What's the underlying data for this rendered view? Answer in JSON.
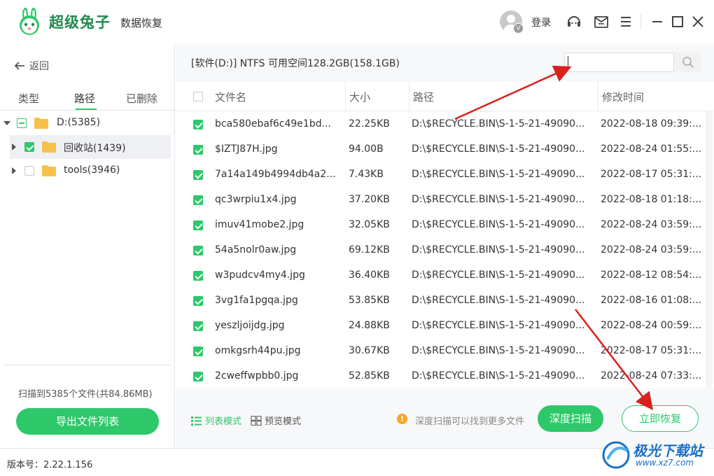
{
  "header": {
    "brand": "超级兔子",
    "brand_sub": "数据恢复",
    "login": "登录",
    "avatar_badge": "V"
  },
  "sidebar": {
    "back": "返回",
    "tabs": [
      {
        "label": "类型",
        "active": false
      },
      {
        "label": "路径",
        "active": true
      },
      {
        "label": "已删除",
        "active": false
      }
    ],
    "tree": [
      {
        "label": "D:(5385)",
        "check": "partial",
        "expanded": true
      },
      {
        "label": "回收站(1439)",
        "check": "checked",
        "expanded": false
      },
      {
        "label": "tools(3946)",
        "check": "unchecked",
        "expanded": false
      }
    ],
    "scan_summary": "扫描到5385个文件(共84.86MB)",
    "export_button": "导出文件列表"
  },
  "main": {
    "drive_info": "[软件(D:)] NTFS 可用空间128.2GB(158.1GB)",
    "search": {
      "value": "",
      "placeholder": ""
    },
    "columns": [
      "文件名",
      "大小",
      "路径",
      "修改时间"
    ],
    "rows": [
      {
        "name": "bca580ebaf6c49e1bd...",
        "size": "22.25KB",
        "path": "D:\\$RECYCLE.BIN\\S-1-5-21-49090...",
        "modified": "2022-08-18 09:39:..."
      },
      {
        "name": "$IZTJ87H.jpg",
        "size": "94.00B",
        "path": "D:\\$RECYCLE.BIN\\S-1-5-21-49090...",
        "modified": "2022-08-24 01:55:..."
      },
      {
        "name": "7a14a149b4994db4a2...",
        "size": "7.43KB",
        "path": "D:\\$RECYCLE.BIN\\S-1-5-21-49090...",
        "modified": "2022-08-17 05:31:..."
      },
      {
        "name": "qc3wrpiu1x4.jpg",
        "size": "37.20KB",
        "path": "D:\\$RECYCLE.BIN\\S-1-5-21-49090...",
        "modified": "2022-08-18 01:18:..."
      },
      {
        "name": "imuv41mobe2.jpg",
        "size": "32.05KB",
        "path": "D:\\$RECYCLE.BIN\\S-1-5-21-49090...",
        "modified": "2022-08-24 03:59:..."
      },
      {
        "name": "54a5nolr0aw.jpg",
        "size": "69.12KB",
        "path": "D:\\$RECYCLE.BIN\\S-1-5-21-49090...",
        "modified": "2022-08-24 03:59:..."
      },
      {
        "name": "w3pudcv4my4.jpg",
        "size": "36.40KB",
        "path": "D:\\$RECYCLE.BIN\\S-1-5-21-49090...",
        "modified": "2022-08-12 08:54:..."
      },
      {
        "name": "3vg1fa1pgqa.jpg",
        "size": "53.85KB",
        "path": "D:\\$RECYCLE.BIN\\S-1-5-21-49090...",
        "modified": "2022-08-16 01:08:..."
      },
      {
        "name": "yeszljoijdg.jpg",
        "size": "24.88KB",
        "path": "D:\\$RECYCLE.BIN\\S-1-5-21-49090...",
        "modified": "2022-08-24 00:59:..."
      },
      {
        "name": "omkgsrh44pu.jpg",
        "size": "30.67KB",
        "path": "D:\\$RECYCLE.BIN\\S-1-5-21-49090...",
        "modified": "2022-08-17 05:31:..."
      },
      {
        "name": "2cweffwpbb0.jpg",
        "size": "52.85KB",
        "path": "D:\\$RECYCLE.BIN\\S-1-5-21-49090...",
        "modified": "2022-08-24 07:33:..."
      }
    ],
    "view_modes": [
      {
        "label": "列表模式",
        "active": true
      },
      {
        "label": "预览模式",
        "active": false
      }
    ],
    "hint": "深度扫描可以找到更多文件",
    "deep_scan_button": "深度扫描",
    "recover_button": "立即恢复"
  },
  "status": {
    "version": "版本号：2.22.1.156"
  },
  "watermark": {
    "title": "极光下载站",
    "url": "www.xz7.com"
  },
  "colors": {
    "accent": "#2ec86a",
    "brand_text": "#1f8a4c",
    "annotation_arrow": "#d9201c",
    "watermark": "#1a6fc4"
  }
}
